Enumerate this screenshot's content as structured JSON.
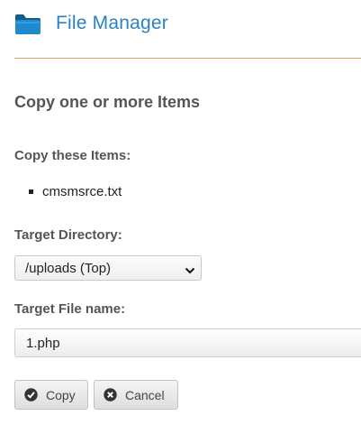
{
  "header": {
    "title": "File Manager",
    "icon": "folder-icon"
  },
  "colors": {
    "title": "#2a82c4",
    "divider": "#e0a15c",
    "folder": "#1b6fa8"
  },
  "form": {
    "section_title": "Copy one or more Items",
    "items_label": "Copy these Items:",
    "items": [
      "cmsmsrce.txt"
    ],
    "target_dir_label": "Target Directory:",
    "target_dir_value": "/uploads (Top)",
    "target_name_label": "Target File name:",
    "target_name_value": "1.php"
  },
  "buttons": {
    "copy_label": "Copy",
    "copy_icon": "checkmark-circle-icon",
    "cancel_label": "Cancel",
    "cancel_icon": "close-circle-icon"
  }
}
